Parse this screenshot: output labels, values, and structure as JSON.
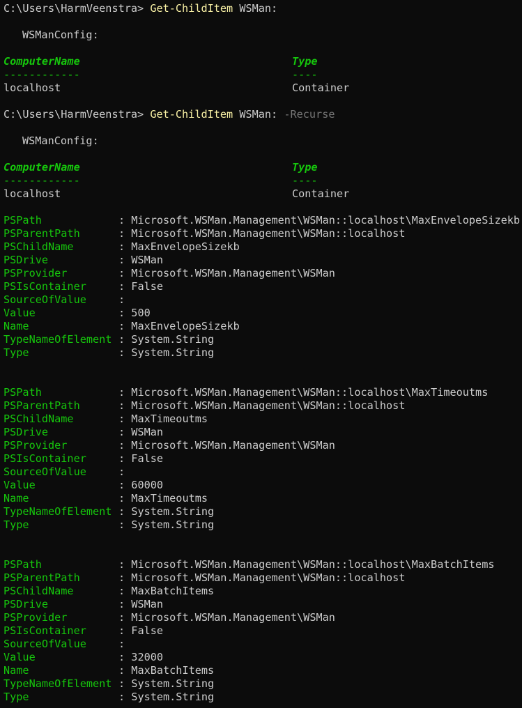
{
  "commands": [
    {
      "prompt": "C:\\Users\\HarmVeenstra> ",
      "cmdlet": "Get-ChildItem",
      "arg": " WSMan:",
      "param": ""
    },
    {
      "prompt": "C:\\Users\\HarmVeenstra> ",
      "cmdlet": "Get-ChildItem",
      "arg": " WSMan: ",
      "param": "-Recurse"
    }
  ],
  "table": {
    "container_label": "WSManConfig:",
    "col1_header": "ComputerName",
    "col2_header": "Type",
    "col1_underline": "------------",
    "col2_underline": "----",
    "col1_value": "localhost",
    "col2_value": "Container"
  },
  "records": [
    {
      "fields": [
        {
          "key": "PSPath",
          "value": "Microsoft.WSMan.Management\\WSMan::localhost\\MaxEnvelopeSizekb"
        },
        {
          "key": "PSParentPath",
          "value": "Microsoft.WSMan.Management\\WSMan::localhost"
        },
        {
          "key": "PSChildName",
          "value": "MaxEnvelopeSizekb"
        },
        {
          "key": "PSDrive",
          "value": "WSMan"
        },
        {
          "key": "PSProvider",
          "value": "Microsoft.WSMan.Management\\WSMan"
        },
        {
          "key": "PSIsContainer",
          "value": "False"
        },
        {
          "key": "SourceOfValue",
          "value": ""
        },
        {
          "key": "Value",
          "value": "500"
        },
        {
          "key": "Name",
          "value": "MaxEnvelopeSizekb"
        },
        {
          "key": "TypeNameOfElement",
          "value": "System.String"
        },
        {
          "key": "Type",
          "value": "System.String"
        }
      ]
    },
    {
      "fields": [
        {
          "key": "PSPath",
          "value": "Microsoft.WSMan.Management\\WSMan::localhost\\MaxTimeoutms"
        },
        {
          "key": "PSParentPath",
          "value": "Microsoft.WSMan.Management\\WSMan::localhost"
        },
        {
          "key": "PSChildName",
          "value": "MaxTimeoutms"
        },
        {
          "key": "PSDrive",
          "value": "WSMan"
        },
        {
          "key": "PSProvider",
          "value": "Microsoft.WSMan.Management\\WSMan"
        },
        {
          "key": "PSIsContainer",
          "value": "False"
        },
        {
          "key": "SourceOfValue",
          "value": ""
        },
        {
          "key": "Value",
          "value": "60000"
        },
        {
          "key": "Name",
          "value": "MaxTimeoutms"
        },
        {
          "key": "TypeNameOfElement",
          "value": "System.String"
        },
        {
          "key": "Type",
          "value": "System.String"
        }
      ]
    },
    {
      "fields": [
        {
          "key": "PSPath",
          "value": "Microsoft.WSMan.Management\\WSMan::localhost\\MaxBatchItems"
        },
        {
          "key": "PSParentPath",
          "value": "Microsoft.WSMan.Management\\WSMan::localhost"
        },
        {
          "key": "PSChildName",
          "value": "MaxBatchItems"
        },
        {
          "key": "PSDrive",
          "value": "WSMan"
        },
        {
          "key": "PSProvider",
          "value": "Microsoft.WSMan.Management\\WSMan"
        },
        {
          "key": "PSIsContainer",
          "value": "False"
        },
        {
          "key": "SourceOfValue",
          "value": ""
        },
        {
          "key": "Value",
          "value": "32000"
        },
        {
          "key": "Name",
          "value": "MaxBatchItems"
        },
        {
          "key": "TypeNameOfElement",
          "value": "System.String"
        },
        {
          "key": "Type",
          "value": "System.String"
        }
      ]
    }
  ],
  "separator": ": ",
  "colors": {
    "background": "#0c0c0c",
    "foreground": "#cccccc",
    "cmdlet": "#f9f1a5",
    "parameter": "#767676",
    "property_key": "#16c60c"
  }
}
